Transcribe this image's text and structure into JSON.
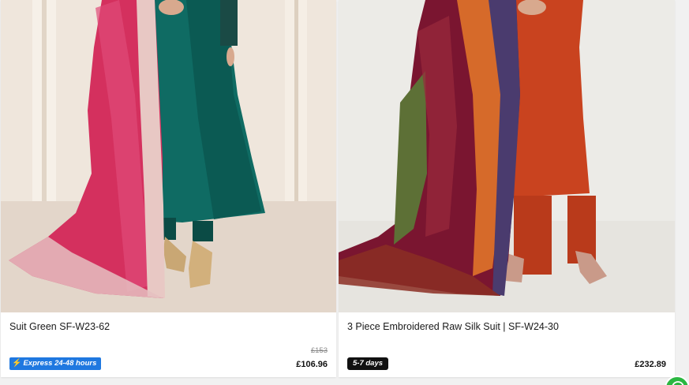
{
  "products": [
    {
      "title": "Suit Green SF-W23-62",
      "old_price": "£153",
      "price": "£106.96",
      "badge": "Express 24-48 hours",
      "badge_icon": "lightning-bolt-icon",
      "badge_color": "#1f78e0"
    },
    {
      "title": "3 Piece Embroidered Raw Silk Suit | SF-W24-30",
      "price": "£232.89",
      "badge": "5-7 days",
      "badge_color": "#111111"
    }
  ],
  "floating_button": {
    "icon": "whatsapp-icon",
    "color": "#2bb741"
  }
}
